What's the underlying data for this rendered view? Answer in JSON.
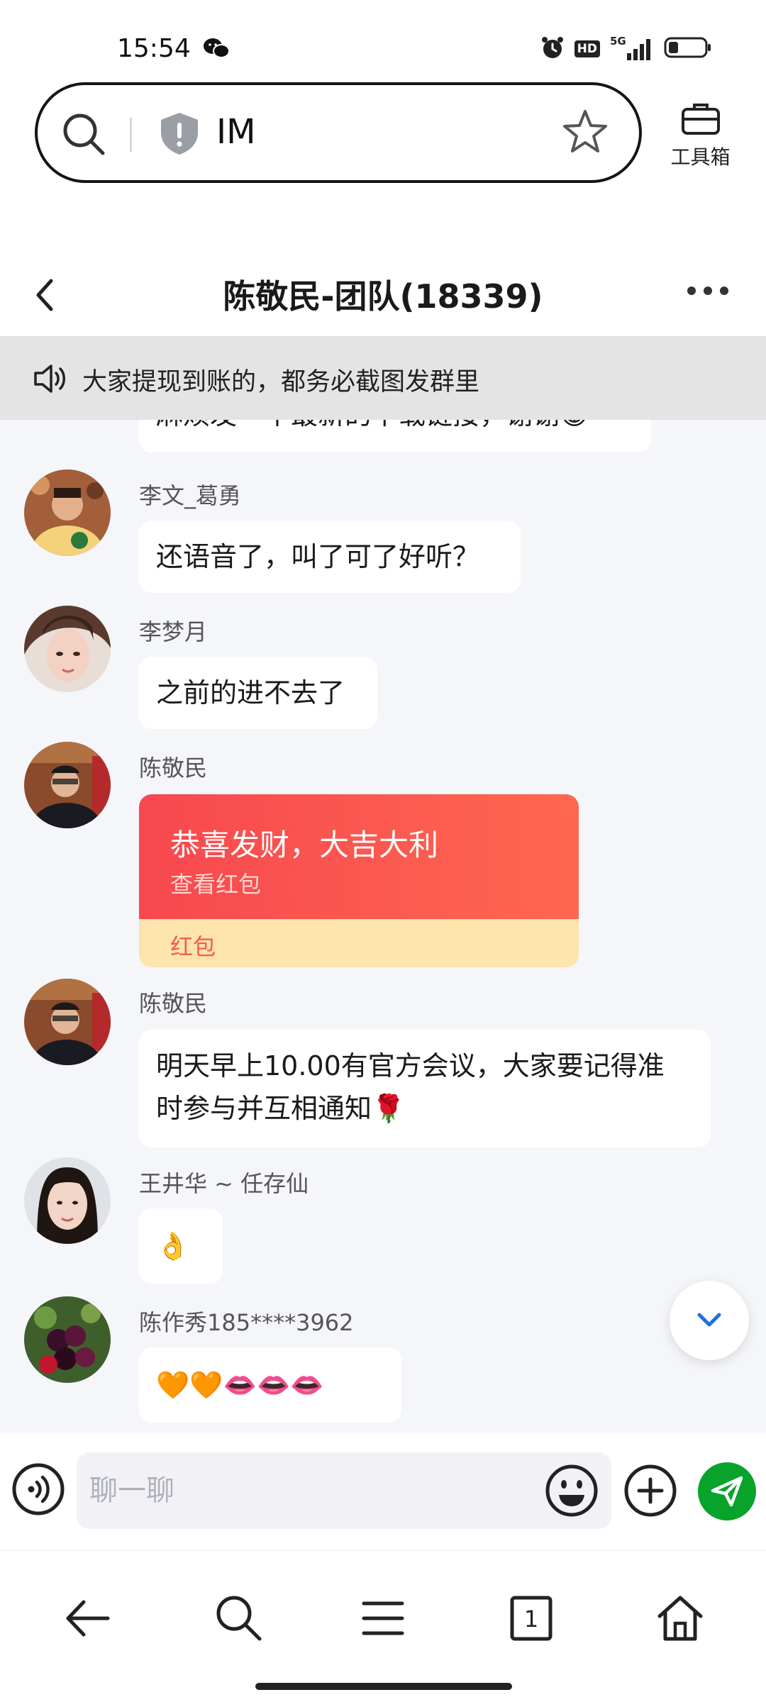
{
  "status_bar": {
    "time": "15:54",
    "network": "5G",
    "hd_badge": "HD",
    "battery_level": 0.25
  },
  "browser": {
    "url_text": "IM",
    "toolbox_label": "工具箱"
  },
  "chat": {
    "title": "陈敬民-团队(18339)",
    "announcement": "大家提现到账的，都务必截图发群里",
    "partial_top_message": "麻烦发一个最新的下载链接，谢谢😁",
    "messages": [
      {
        "sender": "李文_葛勇",
        "text": "还语音了，叫了可了好听？"
      },
      {
        "sender": "李梦月",
        "text": "之前的进不去了"
      },
      {
        "sender": "陈敬民",
        "red_packet": {
          "greeting": "恭喜发财，大吉大利",
          "view_label": "查看红包",
          "type_label": "红包"
        }
      },
      {
        "sender": "陈敬民",
        "text_line1": "明天早上10.00有官方会议，大家要记得准",
        "text_line2": "时参与并互相通知🌹"
      },
      {
        "sender": "王井华 ~ 任存仙",
        "text": "👌"
      },
      {
        "sender": "陈作秀185****3962",
        "text": "🧡🧡👄👄👄"
      }
    ]
  },
  "input": {
    "placeholder": "聊一聊"
  },
  "nav": {
    "tab_count": "1"
  },
  "colors": {
    "send_button": "#08a32a",
    "red_packet_top": "#f7484f",
    "red_packet_bottom": "#fde3ac",
    "scroll_chevron": "#1f6fe0"
  }
}
